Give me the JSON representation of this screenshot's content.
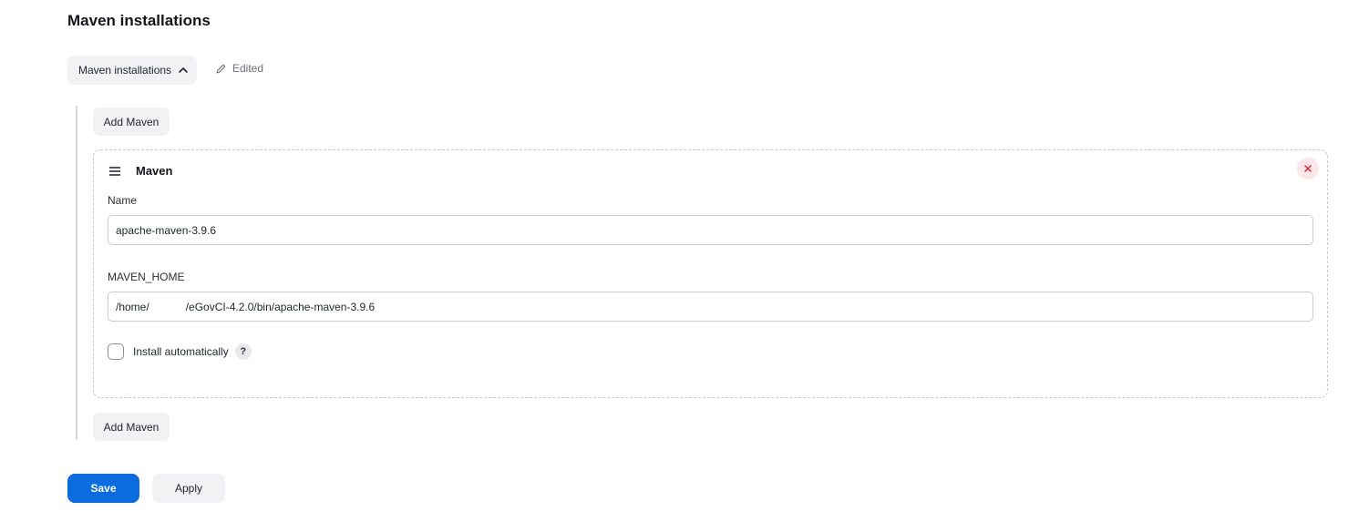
{
  "section": {
    "title": "Maven installations"
  },
  "toggle": {
    "label": "Maven installations",
    "icon": "chevron-up-icon"
  },
  "status": {
    "edited_label": "Edited",
    "icon": "pencil-icon"
  },
  "add_button": {
    "label": "Add Maven"
  },
  "installation": {
    "title": "Maven",
    "drag_icon": "drag-handle-icon",
    "remove_icon": "close-icon",
    "name_label": "Name",
    "name_value": "apache-maven-3.9.6",
    "home_label": "MAVEN_HOME",
    "home_value": "/home/            /eGovCI-4.2.0/bin/apache-maven-3.9.6",
    "install_auto_label": "Install automatically",
    "install_auto_checked": false,
    "help_label": "?"
  },
  "actions": {
    "save_label": "Save",
    "apply_label": "Apply"
  },
  "colors": {
    "primary": "#0b6ce0",
    "remove": "#d9263a"
  }
}
